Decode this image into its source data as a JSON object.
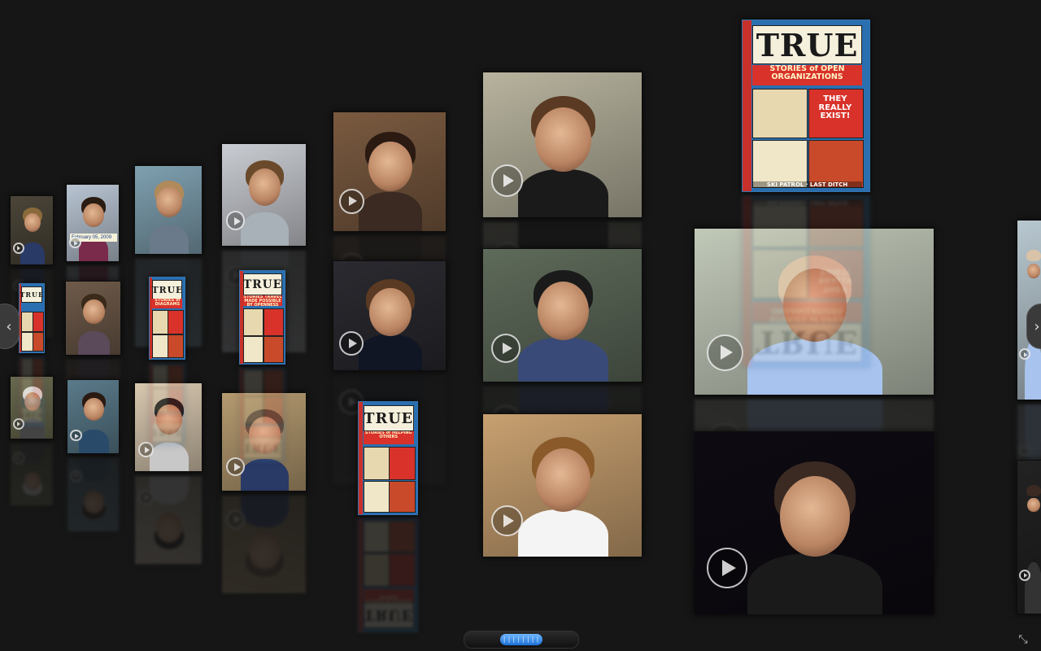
{
  "app": {
    "title": ""
  },
  "comics": [
    {
      "id": "c1",
      "title": "TRUE",
      "strip": "STORIES of OPEN ORGANIZATIONS",
      "panel_text": "THEY REALLY EXIST!",
      "footer": "SKI PATROL · LAST DITCH"
    },
    {
      "id": "c2",
      "title": "TRUE",
      "strip": "",
      "panel_text": "",
      "footer": ""
    },
    {
      "id": "c3",
      "title": "TRUE",
      "strip": "STORIES of DIAGRAMS",
      "panel_text": "",
      "footer": ""
    },
    {
      "id": "c4",
      "title": "TRUE",
      "strip": "STORIES TRAVEL MADE POSSIBLE BY OPENNESS",
      "panel_text": "",
      "footer": ""
    },
    {
      "id": "c5",
      "title": "TRUE",
      "strip": "STORIES of HELPING OTHERS",
      "panel_text": "",
      "footer": ""
    }
  ],
  "videos": [
    {
      "id": "v01",
      "has_play": true,
      "caption": ""
    },
    {
      "id": "v02",
      "has_play": true,
      "caption": "February 05, 2009"
    },
    {
      "id": "v03",
      "has_play": false,
      "caption": ""
    },
    {
      "id": "v04",
      "has_play": true,
      "caption": ""
    },
    {
      "id": "v05",
      "has_play": true,
      "caption": ""
    },
    {
      "id": "v06",
      "has_play": true,
      "caption": ""
    },
    {
      "id": "v07",
      "has_play": false,
      "caption": ""
    },
    {
      "id": "v08",
      "has_play": true,
      "caption": ""
    },
    {
      "id": "v09",
      "has_play": true,
      "caption": ""
    },
    {
      "id": "v10",
      "has_play": true,
      "caption": ""
    },
    {
      "id": "v11",
      "has_play": true,
      "caption": ""
    },
    {
      "id": "v12",
      "has_play": true,
      "caption": ""
    },
    {
      "id": "v13",
      "has_play": true,
      "caption": ""
    },
    {
      "id": "v14",
      "has_play": true,
      "caption": ""
    },
    {
      "id": "v15",
      "has_play": true,
      "caption": ""
    },
    {
      "id": "v16",
      "has_play": true,
      "caption": ""
    },
    {
      "id": "v17",
      "has_play": true,
      "caption": ""
    },
    {
      "id": "v18",
      "has_play": true,
      "caption": ""
    }
  ],
  "controls": {
    "prev_glyph": "‹",
    "next_glyph": "›",
    "scroll_thumb_grip": "||||||||",
    "resize_glyph": "⤡"
  },
  "colors": {
    "background": "#161616",
    "accent": "#1c6fd6",
    "comic_red": "#d8322a",
    "comic_blue": "#2a6fb0"
  }
}
